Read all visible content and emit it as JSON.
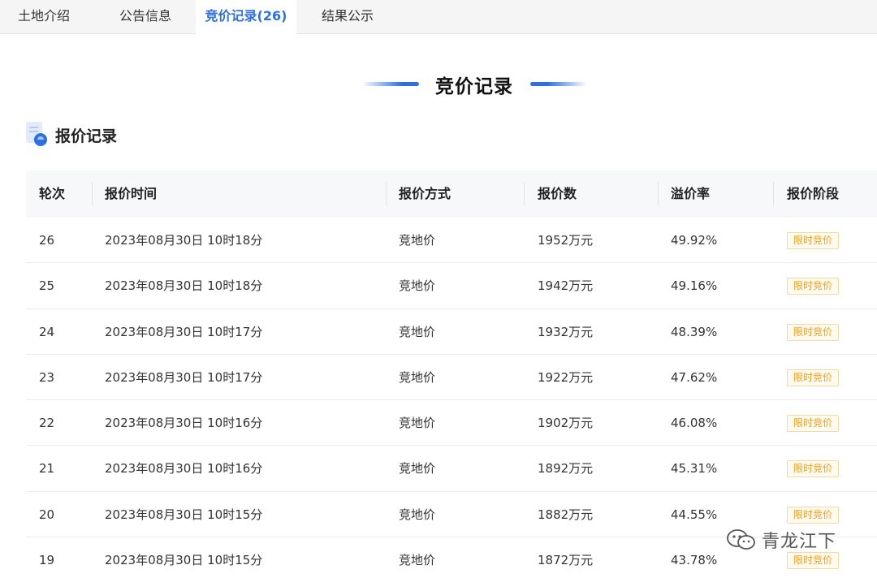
{
  "tabs": [
    {
      "label": "土地介绍"
    },
    {
      "label": "公告信息"
    },
    {
      "label": "竞价记录(26)"
    },
    {
      "label": "结果公示"
    }
  ],
  "section_title": "竞价记录",
  "subsection_title": "报价记录",
  "table": {
    "headers": [
      "轮次",
      "报价时间",
      "报价方式",
      "报价数",
      "溢价率",
      "报价阶段"
    ],
    "rows": [
      {
        "round": "26",
        "time": "2023年08月30日 10时18分",
        "method": "竞地价",
        "amount": "1952万元",
        "premium": "49.92%",
        "stage": "限时竞价"
      },
      {
        "round": "25",
        "time": "2023年08月30日 10时18分",
        "method": "竞地价",
        "amount": "1942万元",
        "premium": "49.16%",
        "stage": "限时竞价"
      },
      {
        "round": "24",
        "time": "2023年08月30日 10时17分",
        "method": "竞地价",
        "amount": "1932万元",
        "premium": "48.39%",
        "stage": "限时竞价"
      },
      {
        "round": "23",
        "time": "2023年08月30日 10时17分",
        "method": "竞地价",
        "amount": "1922万元",
        "premium": "47.62%",
        "stage": "限时竞价"
      },
      {
        "round": "22",
        "time": "2023年08月30日 10时16分",
        "method": "竞地价",
        "amount": "1902万元",
        "premium": "46.08%",
        "stage": "限时竞价"
      },
      {
        "round": "21",
        "time": "2023年08月30日 10时16分",
        "method": "竞地价",
        "amount": "1892万元",
        "premium": "45.31%",
        "stage": "限时竞价"
      },
      {
        "round": "20",
        "time": "2023年08月30日 10时15分",
        "method": "竞地价",
        "amount": "1882万元",
        "premium": "44.55%",
        "stage": "限时竞价"
      },
      {
        "round": "19",
        "time": "2023年08月30日 10时15分",
        "method": "竞地价",
        "amount": "1872万元",
        "premium": "43.78%",
        "stage": "限时竞价"
      }
    ]
  },
  "watermark": {
    "text": "青龙江下",
    "icon": "wechat-icon"
  },
  "colors": {
    "accent": "#2f6fe4",
    "badge_text": "#f0a020",
    "badge_border": "#f5d9a0"
  }
}
